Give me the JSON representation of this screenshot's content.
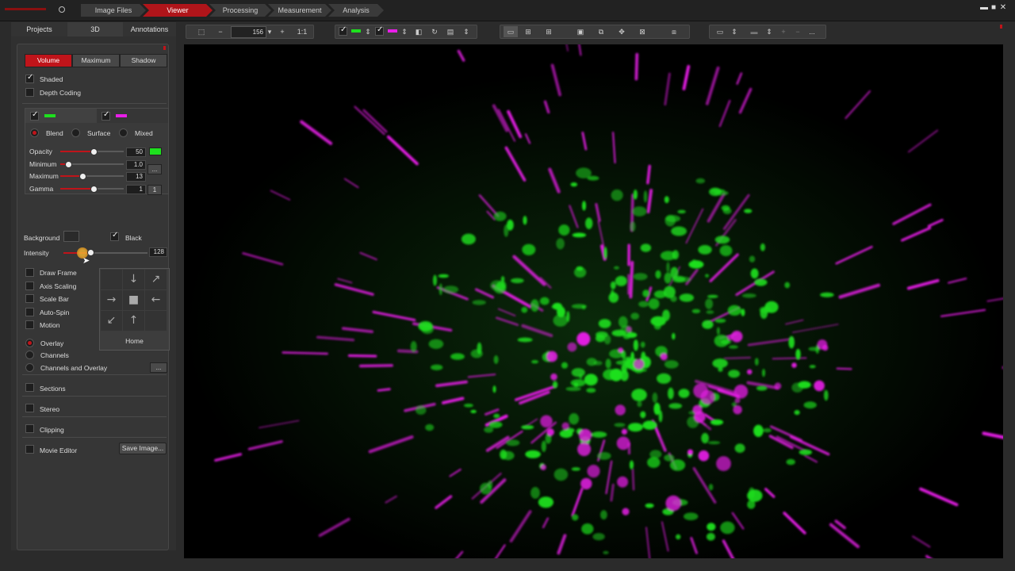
{
  "workflow": {
    "steps": [
      {
        "label": "Image Files",
        "active": false
      },
      {
        "label": "Viewer",
        "active": true
      },
      {
        "label": "Processing",
        "active": false
      },
      {
        "label": "Measurement",
        "active": false
      },
      {
        "label": "Analysis",
        "active": false
      }
    ]
  },
  "window_controls": {
    "minimize": "▬",
    "maximize": "■",
    "close": "✕"
  },
  "panel_tabs": [
    "Projects",
    "3D",
    "Annotations"
  ],
  "render_modes": [
    {
      "label": "Volume",
      "active": true
    },
    {
      "label": "Maximum",
      "active": false
    },
    {
      "label": "Shadow",
      "active": false
    }
  ],
  "shaded": {
    "label": "Shaded",
    "checked": true
  },
  "depth_coding": {
    "label": "Depth Coding",
    "checked": false
  },
  "channels": [
    {
      "color": "#1ee01e",
      "checked": true
    },
    {
      "color": "#e81ee8",
      "checked": true
    }
  ],
  "blend_modes": [
    {
      "label": "Blend",
      "selected": true
    },
    {
      "label": "Surface",
      "selected": false
    },
    {
      "label": "Mixed",
      "selected": false
    }
  ],
  "params": [
    {
      "label": "Opacity",
      "value": "50",
      "level": 0.52
    },
    {
      "label": "Minimum",
      "value": "1.0",
      "level": 0.12
    },
    {
      "label": "Maximum",
      "value": "13",
      "level": 0.35
    },
    {
      "label": "Gamma",
      "value": "1",
      "level": 0.52
    }
  ],
  "background": {
    "label": "Background",
    "black_label": "Black",
    "black_checked": true
  },
  "intensity": {
    "label": "Intensity",
    "value": "128",
    "level": 0.32
  },
  "options": [
    {
      "label": "Draw Frame",
      "checked": false
    },
    {
      "label": "Axis Scaling",
      "checked": false
    },
    {
      "label": "Scale Bar",
      "checked": false
    },
    {
      "label": "Auto-Spin",
      "checked": false
    },
    {
      "label": "Motion",
      "checked": false
    }
  ],
  "nav": {
    "home_label": "Home"
  },
  "overlay_modes": [
    {
      "label": "Overlay",
      "selected": true
    },
    {
      "label": "Channels",
      "selected": false
    },
    {
      "label": "Channels and Overlay",
      "selected": false
    }
  ],
  "more_label": "...",
  "sections": {
    "label": "Sections",
    "checked": false
  },
  "stereo": {
    "label": "Stereo",
    "checked": false
  },
  "clipping": {
    "label": "Clipping",
    "checked": false
  },
  "movie_editor": {
    "label": "Movie Editor",
    "checked": false
  },
  "save_image_label": "Save Image...",
  "toolbar": {
    "zoom_value": "156",
    "zoom_minus": "−",
    "zoom_plus": "+",
    "zoom_one": "1:1",
    "dots": "..."
  },
  "colors": {
    "accent": "#c0141a",
    "green_channel": "#1ee01e",
    "magenta_channel": "#e81ee8"
  }
}
